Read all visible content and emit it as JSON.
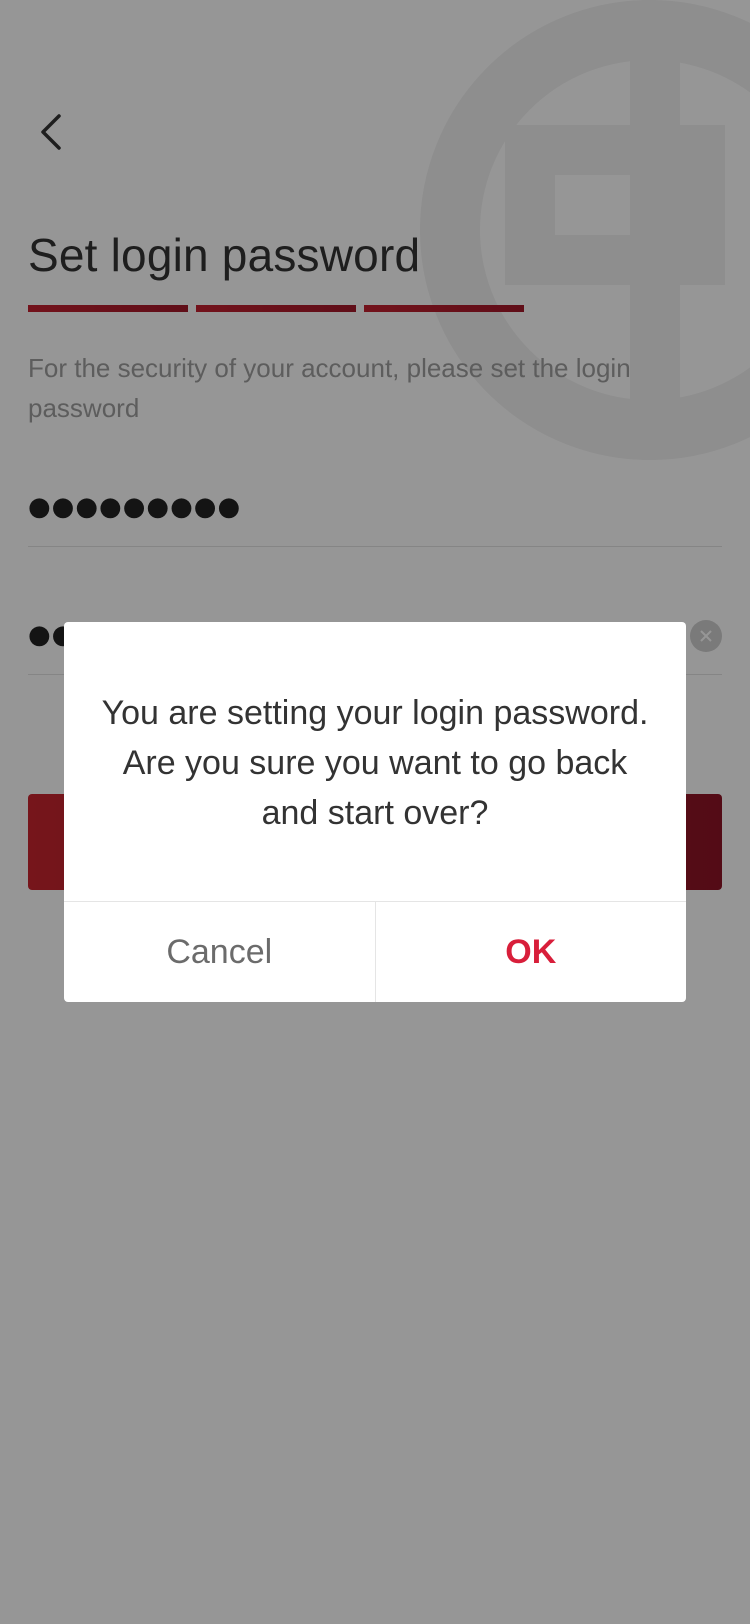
{
  "header": {
    "back_icon": "chevron-left-icon"
  },
  "page": {
    "title": "Set login password",
    "subtitle": "For the security of your account, please set the login password",
    "progress_segments": 3,
    "fields": [
      {
        "value": "●●●●●●●●●"
      },
      {
        "value": "●●",
        "clear_icon": "clear-icon"
      }
    ]
  },
  "dialog": {
    "message": "You are setting your login password. Are you sure you want to go back and start over?",
    "cancel_label": "Cancel",
    "ok_label": "OK"
  },
  "colors": {
    "accent": "#c3202f",
    "ok_text": "#d81e3a",
    "overlay": "rgba(0,0,0,0.41)"
  }
}
